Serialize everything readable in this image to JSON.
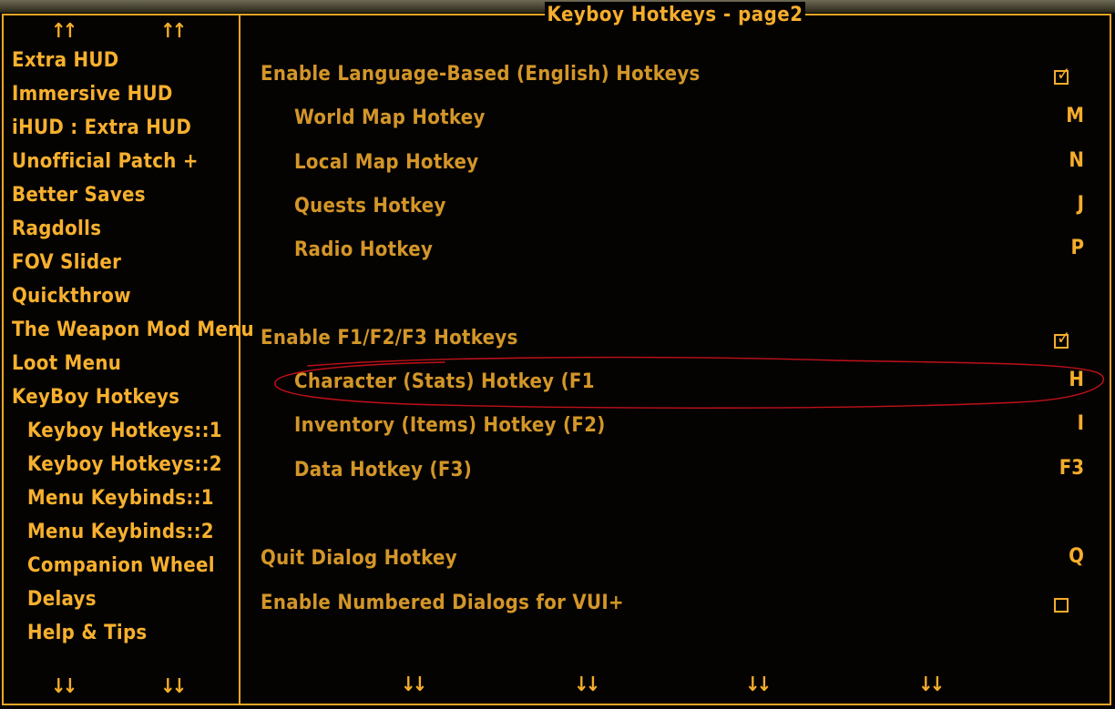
{
  "title": "Keyboy Hotkeys - page2",
  "sidebar": {
    "items": [
      {
        "label": "Extra HUD"
      },
      {
        "label": "Immersive HUD"
      },
      {
        "label": "iHUD : Extra HUD"
      },
      {
        "label": "Unofficial Patch +"
      },
      {
        "label": "Better Saves"
      },
      {
        "label": "Ragdolls"
      },
      {
        "label": "FOV Slider"
      },
      {
        "label": "Quickthrow"
      },
      {
        "label": "The Weapon Mod Menu"
      },
      {
        "label": "Loot Menu"
      },
      {
        "label": "KeyBoy Hotkeys"
      },
      {
        "label": "Keyboy Hotkeys::1"
      },
      {
        "label": "Keyboy Hotkeys::2"
      },
      {
        "label": "Menu Keybinds::1"
      },
      {
        "label": "Menu Keybinds::2"
      },
      {
        "label": "Companion Wheel"
      },
      {
        "label": "Delays"
      },
      {
        "label": "Help & Tips"
      }
    ],
    "scroll_up_glyph": "↑↑",
    "scroll_down_glyph": "↓↓"
  },
  "options": [
    {
      "label": "Enable Language-Based (English) Hotkeys",
      "type": "checkbox",
      "checked": true
    },
    {
      "label": "World Map Hotkey",
      "value": "M"
    },
    {
      "label": "Local Map Hotkey",
      "value": "N"
    },
    {
      "label": "Quests Hotkey",
      "value": "J"
    },
    {
      "label": "Radio Hotkey",
      "value": "P"
    },
    {
      "label": "Enable F1/F2/F3 Hotkeys",
      "type": "checkbox",
      "checked": true
    },
    {
      "label": "Character (Stats) Hotkey (F1",
      "value": "H"
    },
    {
      "label": "Inventory (Items) Hotkey (F2)",
      "value": "I"
    },
    {
      "label": "Data Hotkey (F3)",
      "value": "F3"
    },
    {
      "label": "Quit Dialog Hotkey",
      "value": "Q"
    },
    {
      "label": "Enable Numbered Dialogs for VUI+",
      "type": "checkbox",
      "checked": false
    }
  ],
  "checkmark_glyph": "✓",
  "colors": {
    "accent": "#f5ad2c",
    "label": "#d39628",
    "annotation": "#c0101a",
    "background": "#050302"
  }
}
